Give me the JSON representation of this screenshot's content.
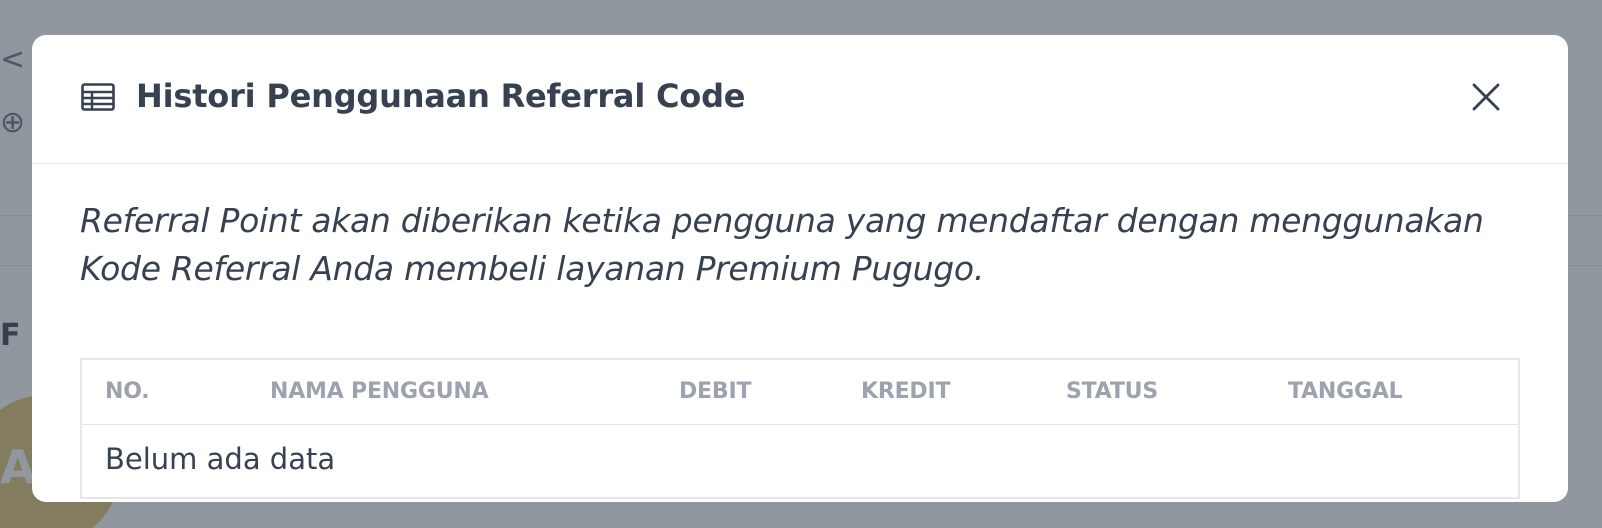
{
  "background": {
    "row1_fragment": "< C",
    "row2_fragment": "⊕ R",
    "row3_fragment": "F",
    "avatar_letter": "A"
  },
  "modal": {
    "title": "Histori Penggunaan Referral Code",
    "title_icon": "table-icon",
    "close_icon": "close-icon",
    "description": "Referral Point akan diberikan ketika pengguna yang mendaftar dengan menggunakan Kode Referral Anda membeli layanan Premium Pugugo.",
    "table": {
      "columns": [
        "NO.",
        "NAMA PENGGUNA",
        "DEBIT",
        "KREDIT",
        "STATUS",
        "TANGGAL"
      ],
      "empty_message": "Belum ada data"
    }
  },
  "colors": {
    "overlay": "#374151",
    "text_primary": "#374151",
    "header_text": "#9ca3af",
    "border": "#e5e7eb"
  }
}
